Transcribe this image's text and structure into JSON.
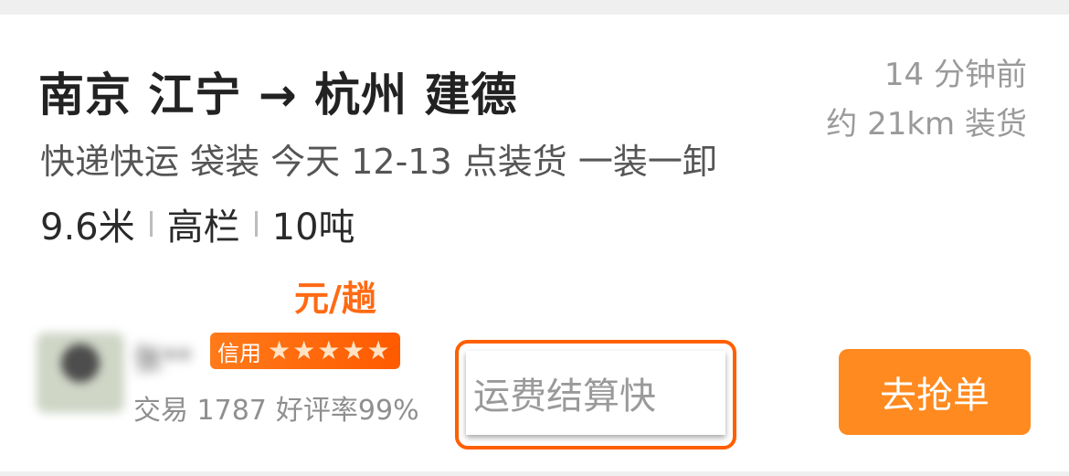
{
  "order": {
    "route": "南京 江宁 → 杭州 建德",
    "time_ago": "14 分钟前",
    "distance": "约 21km 装货",
    "description": "快递快运 袋装 今天 12-13 点装货 一装一卸",
    "specs": {
      "length": "9.6米",
      "truck_type": "高栏",
      "weight": "10吨"
    },
    "price_unit": "元/趟"
  },
  "shipper": {
    "name": "张**",
    "credit_label": "信用",
    "stars": 5,
    "trade_text": "交易 1787",
    "rating_text": "好评率99%"
  },
  "tag": {
    "settle_label": "运费结算快"
  },
  "actions": {
    "grab_label": "去抢单"
  },
  "colors": {
    "accent": "#ff6a13",
    "button": "#ff8a1f",
    "highlight_border": "#ff5f00"
  }
}
